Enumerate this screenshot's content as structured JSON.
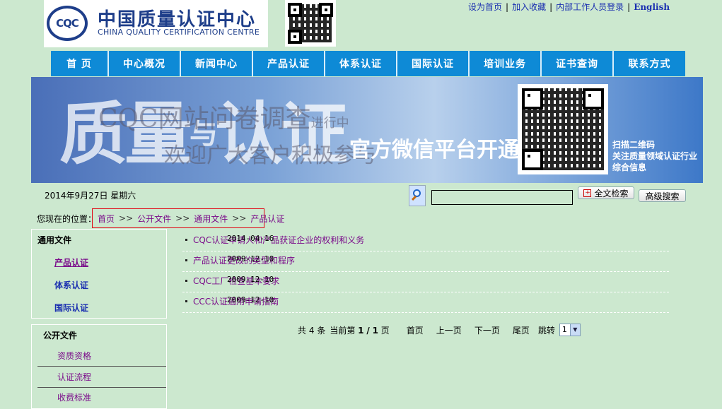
{
  "header": {
    "logo_mark": "CQC",
    "logo_cn": "中国质量认证中心",
    "logo_en": "CHINA QUALITY CERTIFICATION CENTRE",
    "top_links": [
      "设为首页",
      "加入收藏",
      "内部工作人员登录",
      "English"
    ]
  },
  "nav": [
    "首  页",
    "中心概况",
    "新闻中心",
    "产品认证",
    "体系认证",
    "国际认证",
    "培训业务",
    "证书查询",
    "联系方式"
  ],
  "banner": {
    "headline_left": "质量",
    "headline_right": "认证",
    "headline_small": "与",
    "wechat": "官方微信平台开通",
    "survey": "CQC网站问卷调查",
    "survey_small": "进行中",
    "welcome": "欢迎广大客户积极参与",
    "qr_caption": [
      "扫描二维码",
      "关注质量领域认证行业",
      "综合信息"
    ]
  },
  "date": "2014年9月27日  星期六",
  "search": {
    "value": "",
    "fulltext_button": "全文检索",
    "advanced_button": "高级搜索"
  },
  "breadcrumb": {
    "label": "您现在的位置：",
    "items": [
      "首页",
      "公开文件",
      "通用文件",
      "产品认证"
    ]
  },
  "sidebar_general": {
    "title": "通用文件",
    "items": [
      "产品认证",
      "体系认证",
      "国际认证"
    ]
  },
  "sidebar_public": {
    "title": "公开文件",
    "items": [
      "资质资格",
      "认证流程",
      "收费标准"
    ]
  },
  "documents": [
    {
      "title": "CQC认证申请人和产品获证企业的权利和义务",
      "date": "2014-04-16"
    },
    {
      "title": "产品认证更改的类型和程序",
      "date": "2009-12-10"
    },
    {
      "title": "CQC工厂检查基本要求",
      "date": "2009-12-10"
    },
    {
      "title": "CCC认证通用申请指南",
      "date": "2009-12-10"
    }
  ],
  "pager": {
    "total_prefix": "共",
    "total": "4",
    "total_suffix": "条",
    "current_prefix": "当前第",
    "current": "1",
    "slash": "/",
    "pages": "1",
    "pages_suffix": "页",
    "first": "首页",
    "prev": "上一页",
    "next": "下一页",
    "last": "尾页",
    "jump": "跳转",
    "jump_value": "1"
  },
  "colors": {
    "background": "#cce8cf",
    "nav": "#0e8ad6",
    "link": "#7a0a8a",
    "highlight_box": "#e2000f"
  }
}
